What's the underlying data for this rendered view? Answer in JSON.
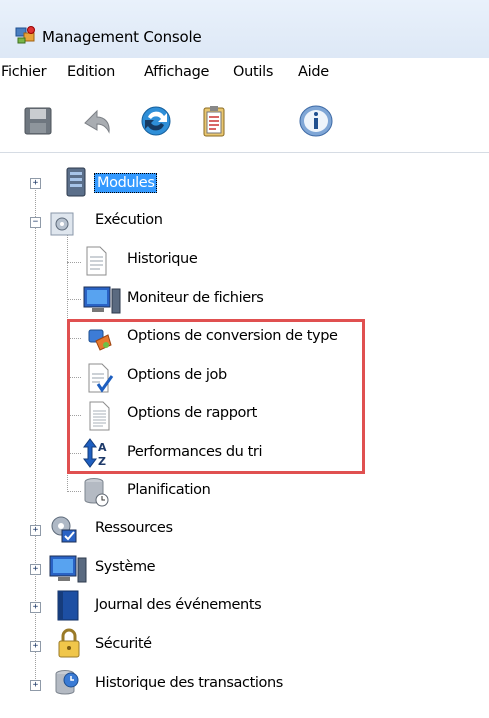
{
  "window": {
    "title": "Management Console"
  },
  "menu": [
    {
      "label": "Fichier"
    },
    {
      "label": "Edition"
    },
    {
      "label": "Affichage"
    },
    {
      "label": "Outils"
    },
    {
      "label": "Aide"
    }
  ],
  "toolbar": {
    "buttons": [
      {
        "icon": "save-icon"
      },
      {
        "icon": "undo-icon"
      },
      {
        "icon": "refresh-icon"
      },
      {
        "icon": "clipboard-icon"
      },
      {
        "icon": "info-icon"
      }
    ]
  },
  "tree": {
    "modules": "Modules",
    "execution": "Exécution",
    "historique": "Historique",
    "moniteur": "Moniteur de fichiers",
    "options_conversion": "Options de conversion de type",
    "options_job": "Options de job",
    "options_rapport": "Options de rapport",
    "performances_tri": "Performances du tri",
    "planification": "Planification",
    "ressources": "Ressources",
    "systeme": "Système",
    "journal": "Journal des événements",
    "securite": "Sécurité",
    "historique_transactions": "Historique des transactions"
  },
  "colors": {
    "selection": "#3399ff",
    "highlight_border": "#e05050",
    "titlebar": "#dde8f6"
  }
}
